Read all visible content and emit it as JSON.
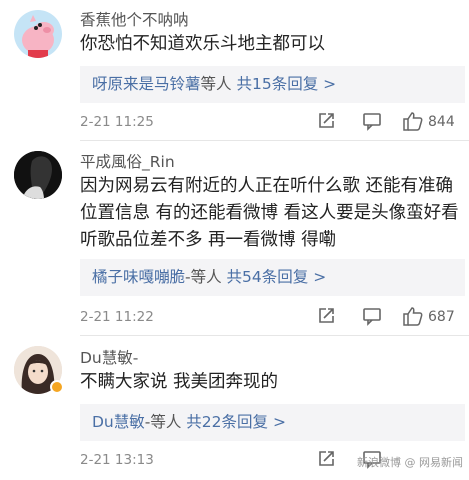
{
  "comments": [
    {
      "username": "香蕉他个不呐呐",
      "content_lines": [
        "你恐怕不知道欢乐斗地主都可以"
      ],
      "reply_user": "呀原来是马铃薯",
      "reply_mid": "等人",
      "reply_count": "共15条回复 >",
      "time": "2-21 11:25",
      "likes": "844"
    },
    {
      "username": "平成風俗_Rin",
      "content_lines": [
        "因为网易云有附近的人正在听什么歌 还能有准确",
        "位置信息 有的还能看微博 看这人要是头像蛮好看",
        "听歌品位差不多 再一看微博 得嘞"
      ],
      "reply_user": "橘子味嘎嘣脆",
      "reply_mid": "-等人",
      "reply_count": "共54条回复 >",
      "time": "2-21 11:22",
      "likes": "687"
    },
    {
      "username": "Du慧敏-",
      "content_lines": [
        "不瞒大家说 我美团奔现的"
      ],
      "reply_user": "Du慧敏",
      "reply_mid": "-等人",
      "reply_count": "共22条回复 >",
      "time": "2-21 13:13",
      "likes": "",
      "watermark": "新浪微博 @ 网易新闻"
    }
  ],
  "colors": {
    "link": "#4a6fa5",
    "time": "#8a8a8a",
    "reply_bg": "#f4f4f6"
  }
}
